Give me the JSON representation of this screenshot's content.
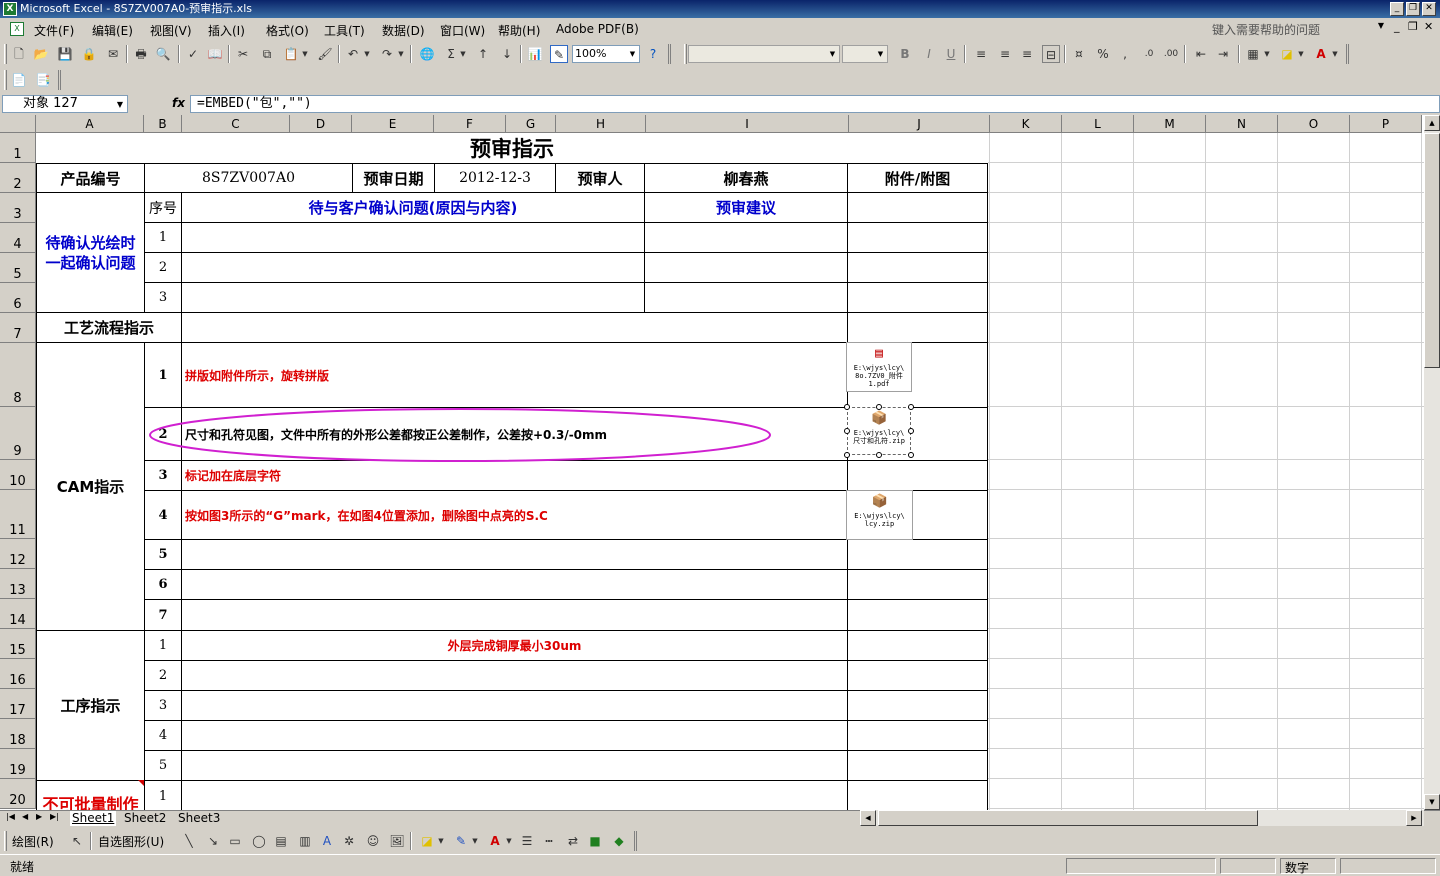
{
  "window": {
    "title": "Microsoft Excel - 8S7ZV007A0-预审指示.xls",
    "app_icon": "X"
  },
  "menu": {
    "items": [
      "文件(F)",
      "编辑(E)",
      "视图(V)",
      "插入(I)",
      "格式(O)",
      "工具(T)",
      "数据(D)",
      "窗口(W)",
      "帮助(H)",
      "Adobe PDF(B)"
    ],
    "help_placeholder": "键入需要帮助的问题"
  },
  "toolbar": {
    "zoom": "100%"
  },
  "formula_bar": {
    "name_box": "对象 127",
    "fx": "fx",
    "formula": "=EMBED(\"包\",\"\")"
  },
  "columns": [
    "A",
    "B",
    "C",
    "D",
    "E",
    "F",
    "G",
    "H",
    "I",
    "J",
    "K",
    "L",
    "M",
    "N",
    "O",
    "P"
  ],
  "rows": [
    "1",
    "2",
    "3",
    "4",
    "5",
    "6",
    "7",
    "8",
    "9",
    "10",
    "11",
    "12",
    "13",
    "14",
    "15",
    "16",
    "17",
    "18",
    "19",
    "20"
  ],
  "sheet": {
    "title": "预审指示",
    "product_no_label": "产品编号",
    "product_no": "8S7ZV007A0",
    "review_date_label": "预审日期",
    "review_date": "2012-12-3",
    "reviewer_label": "预审人",
    "reviewer": "柳春燕",
    "attachment_label": "附件/附图",
    "confirm_section": "待确认光绘时一起确认问题",
    "seq_label": "序号",
    "question_header": "待与客户确认问题(原因与内容)",
    "suggestion_header": "预审建议",
    "confirm_rows": [
      "1",
      "2",
      "3"
    ],
    "process_flow_label": "工艺流程指示",
    "cam_label": "CAM指示",
    "cam_rows": [
      {
        "no": "1",
        "text": "拼版如附件所示，旋转拼版"
      },
      {
        "no": "2",
        "text": "尺寸和孔符见图，文件中所有的外形公差都按正公差制作，公差按+0.3/-0mm"
      },
      {
        "no": "3",
        "text": "标记加在底层字符"
      },
      {
        "no": "4",
        "text": "按如图3所示的“G”mark，在如图4位置添加，删除图中点亮的S.C"
      },
      {
        "no": "5",
        "text": ""
      },
      {
        "no": "6",
        "text": ""
      },
      {
        "no": "7",
        "text": ""
      }
    ],
    "process_label": "工序指示",
    "process_rows": [
      {
        "no": "1",
        "text": "外层完成铜厚最小30um"
      },
      {
        "no": "2",
        "text": ""
      },
      {
        "no": "3",
        "text": ""
      },
      {
        "no": "4",
        "text": ""
      },
      {
        "no": "5",
        "text": ""
      }
    ],
    "no_batch_label": "不可批量制作",
    "no_batch_rows": [
      "1"
    ],
    "embeds": [
      {
        "icon": "pdf-icon",
        "line1": "E:\\wjys\\lcy\\",
        "line2": "8o.7ZV0_附件1.pdf"
      },
      {
        "icon": "package-icon",
        "line1": "E:\\wjys\\lcy\\",
        "line2": "尺寸和孔符.zip"
      },
      {
        "icon": "package-icon",
        "line1": "E:\\wjys\\lcy\\",
        "line2": "lcy.zip"
      }
    ]
  },
  "tabs": [
    "Sheet1",
    "Sheet2",
    "Sheet3"
  ],
  "drawing": {
    "draw_label": "绘图(R)",
    "autoshape_label": "自选图形(U)"
  },
  "status": {
    "ready": "就绪",
    "mode": "数字"
  },
  "colors": {
    "blue_text": "#0000cc",
    "red_text": "#dd0000",
    "highlight_ellipse": "#d020d0"
  }
}
